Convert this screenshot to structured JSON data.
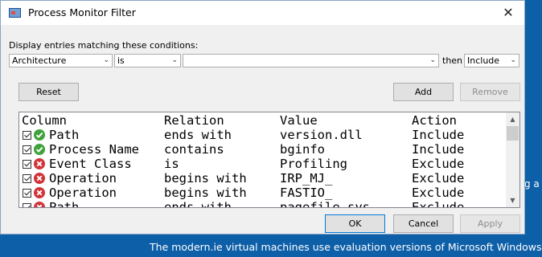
{
  "desktop": {
    "right_text": "g a",
    "bottom_text": "The modern.ie virtual machines use evaluation versions of Microsoft Windows, and"
  },
  "window": {
    "title": "Process Monitor Filter",
    "close_glyph": "✕"
  },
  "filter": {
    "hint": "Display entries matching these conditions:",
    "column_value": "Architecture",
    "relation_value": "is",
    "value_text": "",
    "then_label": "then",
    "action_value": "Include"
  },
  "buttons": {
    "reset": "Reset",
    "add": "Add",
    "remove": "Remove",
    "ok": "OK",
    "cancel": "Cancel",
    "apply": "Apply"
  },
  "list": {
    "headers": [
      "Column",
      "Relation",
      "Value",
      "Action"
    ],
    "rows": [
      {
        "column": "Path",
        "relation": "ends with",
        "value": "version.dll",
        "action": "Include",
        "status": "include",
        "checked": true
      },
      {
        "column": "Process Name",
        "relation": "contains",
        "value": "bginfo",
        "action": "Include",
        "status": "include",
        "checked": true
      },
      {
        "column": "Event Class",
        "relation": "is",
        "value": "Profiling",
        "action": "Exclude",
        "status": "exclude",
        "checked": true
      },
      {
        "column": "Operation",
        "relation": "begins with",
        "value": "IRP_MJ_",
        "action": "Exclude",
        "status": "exclude",
        "checked": true
      },
      {
        "column": "Operation",
        "relation": "begins with",
        "value": "FASTIO_",
        "action": "Exclude",
        "status": "exclude",
        "checked": true
      },
      {
        "column": "Path",
        "relation": "ends with",
        "value": "pagefile.sys",
        "action": "Exclude",
        "status": "exclude",
        "checked": true
      }
    ],
    "scroll_up_glyph": "▲",
    "scroll_down_glyph": "▼"
  },
  "colors": {
    "include_icon": "#3fa23a",
    "exclude_icon": "#d13438",
    "desktop": "#0d5fa8"
  }
}
